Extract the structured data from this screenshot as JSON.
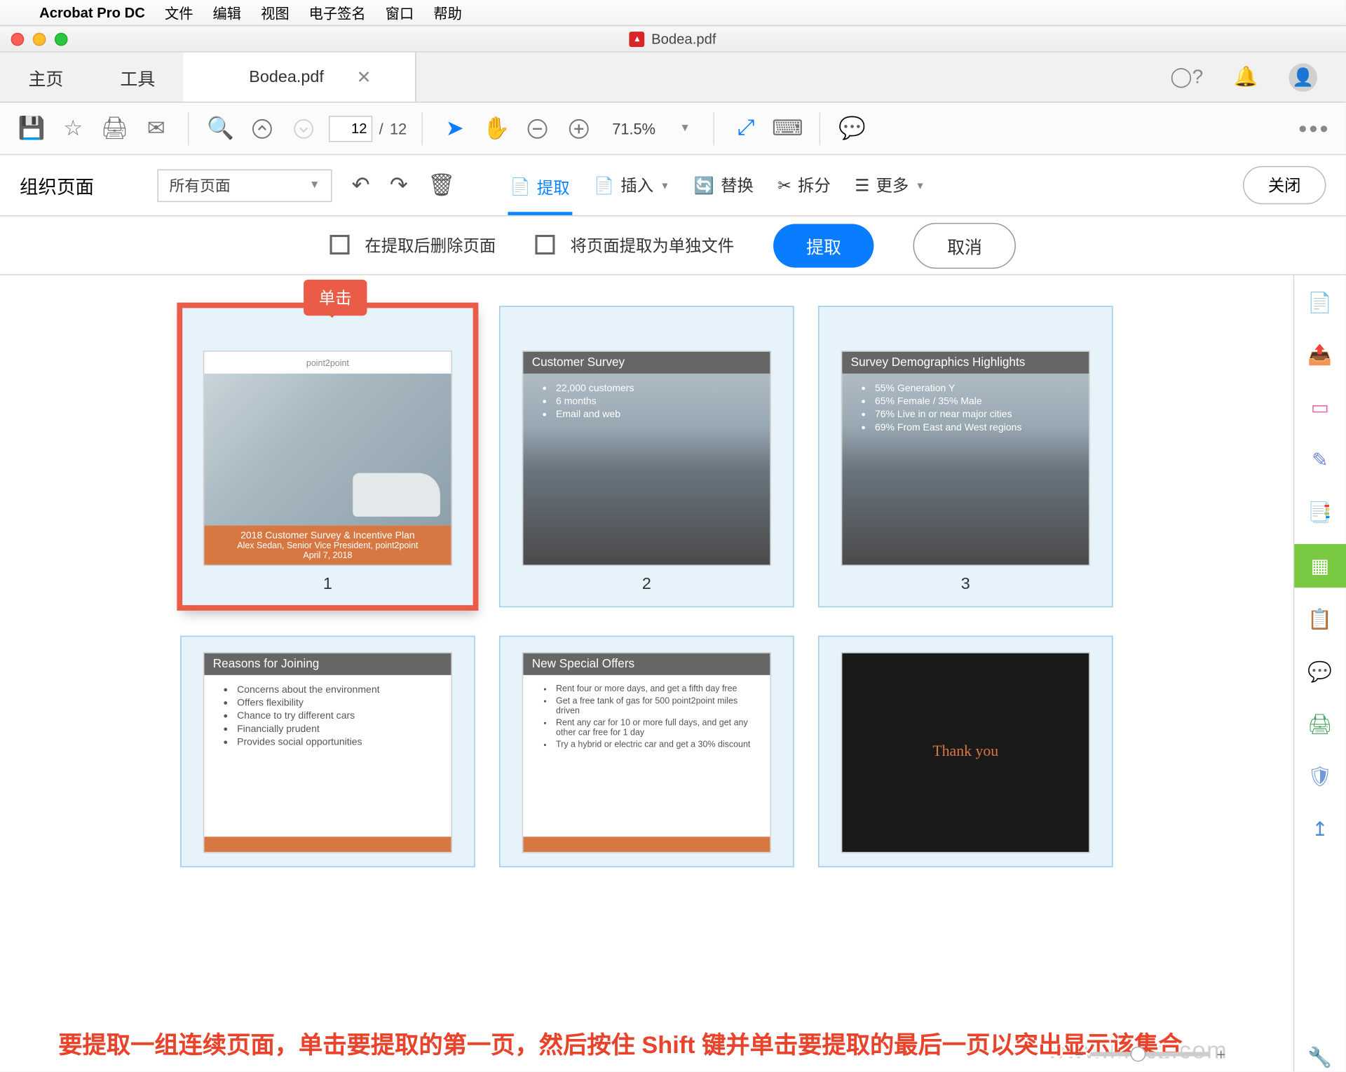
{
  "menubar": {
    "app": "Acrobat Pro DC",
    "items": [
      "文件",
      "编辑",
      "视图",
      "电子签名",
      "窗口",
      "帮助"
    ]
  },
  "window_title": "Bodea.pdf",
  "tabs": {
    "home": "主页",
    "tools": "工具",
    "doc": "Bodea.pdf"
  },
  "toolbar": {
    "page_current": "12",
    "page_sep": "/",
    "page_total": "12",
    "zoom": "71.5%"
  },
  "organize": {
    "title": "组织页面",
    "dropdown": "所有页面",
    "extract": "提取",
    "insert": "插入",
    "replace": "替换",
    "split": "拆分",
    "more": "更多",
    "close": "关闭"
  },
  "extract_opts": {
    "delete_after": "在提取后删除页面",
    "as_separate": "将页面提取为单独文件",
    "extract_btn": "提取",
    "cancel_btn": "取消"
  },
  "callout": "单击",
  "thumbs": {
    "1": "1",
    "2": "2",
    "3": "3"
  },
  "slides": {
    "s1": {
      "brand": "point2point",
      "title": "2018 Customer Survey & Incentive Plan",
      "sub1": "Alex Sedan, Senior Vice President, point2point",
      "sub2": "April 7, 2018"
    },
    "s2": {
      "title": "Customer Survey",
      "b1": "22,000 customers",
      "b2": "6 months",
      "b3": "Email and web"
    },
    "s3": {
      "title": "Survey Demographics Highlights",
      "b1": "55% Generation Y",
      "b2": "65% Female / 35% Male",
      "b3": "76% Live in or near major cities",
      "b4": "69% From East and West regions"
    },
    "s4": {
      "title": "Reasons for Joining",
      "b1": "Concerns about the environment",
      "b2": "Offers flexibility",
      "b3": "Chance to try different cars",
      "b4": "Financially prudent",
      "b5": "Provides social opportunities"
    },
    "s5": {
      "title": "New Special Offers",
      "b1": "Rent four or more days, and get a fifth day free",
      "b2": "Get a free tank of gas for 500 point2point miles driven",
      "b3": "Rent any car for 10 or more full days, and get any other car free for 1 day",
      "b4": "Try a hybrid or electric car and get a 30% discount"
    },
    "s6": {
      "title": "Thank you"
    }
  },
  "instruction": "要提取一组连续页面，单击要提取的第一页，然后按住 Shift 键并单击要提取的最后一页以突出显示该集合",
  "watermark": "www.Macz.com"
}
